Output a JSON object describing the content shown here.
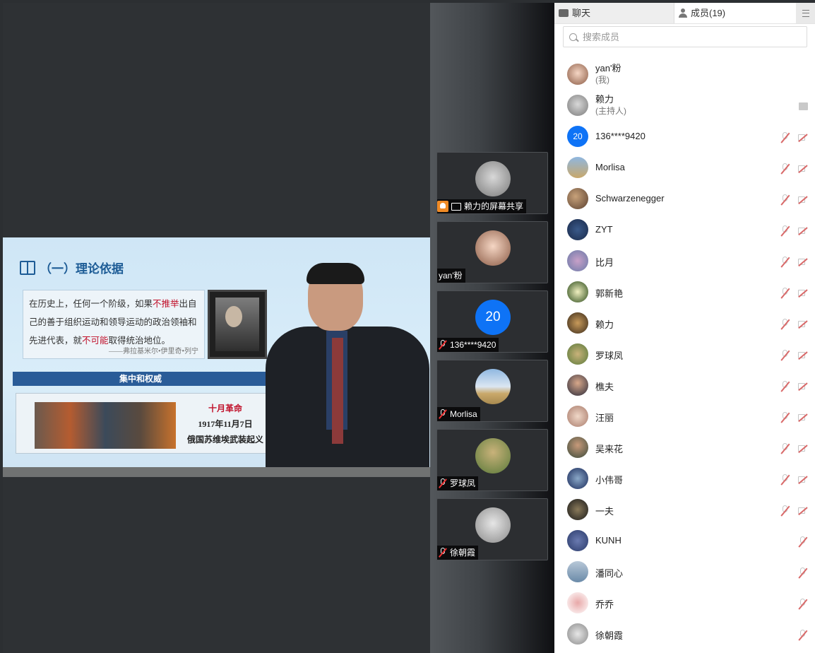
{
  "slide": {
    "title": "（一）理论依据",
    "quote_plain1": "在历史上，任何一个阶级，如果",
    "quote_red1": "不推举",
    "quote_plain2": "出自己的善于组织运动和领导运动的政治领袖和先进代表，就",
    "quote_red2": "不可能",
    "quote_plain3": "取得统治地位。",
    "quote_signature": "——弗拉基米尔•伊里奇•列宁",
    "banner": "集中和权威",
    "scroll_line1": "十月革命",
    "scroll_line2": "1917年11月7日",
    "scroll_line3": "俄国苏维埃武装起义"
  },
  "tiles": [
    {
      "name": "赖力的屏幕共享",
      "type": "share"
    },
    {
      "name": "yan'粉",
      "type": "plain"
    },
    {
      "name": "136****9420",
      "type": "muted",
      "avatar_text": "20"
    },
    {
      "name": "Morlisa",
      "type": "muted"
    },
    {
      "name": "罗球凤",
      "type": "muted"
    },
    {
      "name": "徐朝霞",
      "type": "muted"
    }
  ],
  "panel": {
    "tab_chat": "聊天",
    "tab_members": "成员(19)",
    "search_placeholder": "搜索成员",
    "members": [
      {
        "name": "yan'粉",
        "sub": "(我)"
      },
      {
        "name": "赖力",
        "sub": "(主持人)"
      },
      {
        "name": "136****9420",
        "avatar_text": "20"
      },
      {
        "name": "Morlisa"
      },
      {
        "name": "Schwarzenegger"
      },
      {
        "name": "ZYT"
      },
      {
        "name": "比月"
      },
      {
        "name": "郭新艳"
      },
      {
        "name": "赖力"
      },
      {
        "name": "罗球凤"
      },
      {
        "name": "樵夫"
      },
      {
        "name": "汪丽"
      },
      {
        "name": "吴来花"
      },
      {
        "name": "小伟哥"
      },
      {
        "name": "一夫"
      },
      {
        "name": "KUNH"
      },
      {
        "name": "潘同心"
      },
      {
        "name": "乔乔"
      },
      {
        "name": "徐朝霞"
      }
    ]
  },
  "colors": {
    "accent_blue": "#0e73f6",
    "slide_title": "#1d5c96",
    "quote_red": "#c0102a",
    "share_orange": "#f08a24"
  }
}
